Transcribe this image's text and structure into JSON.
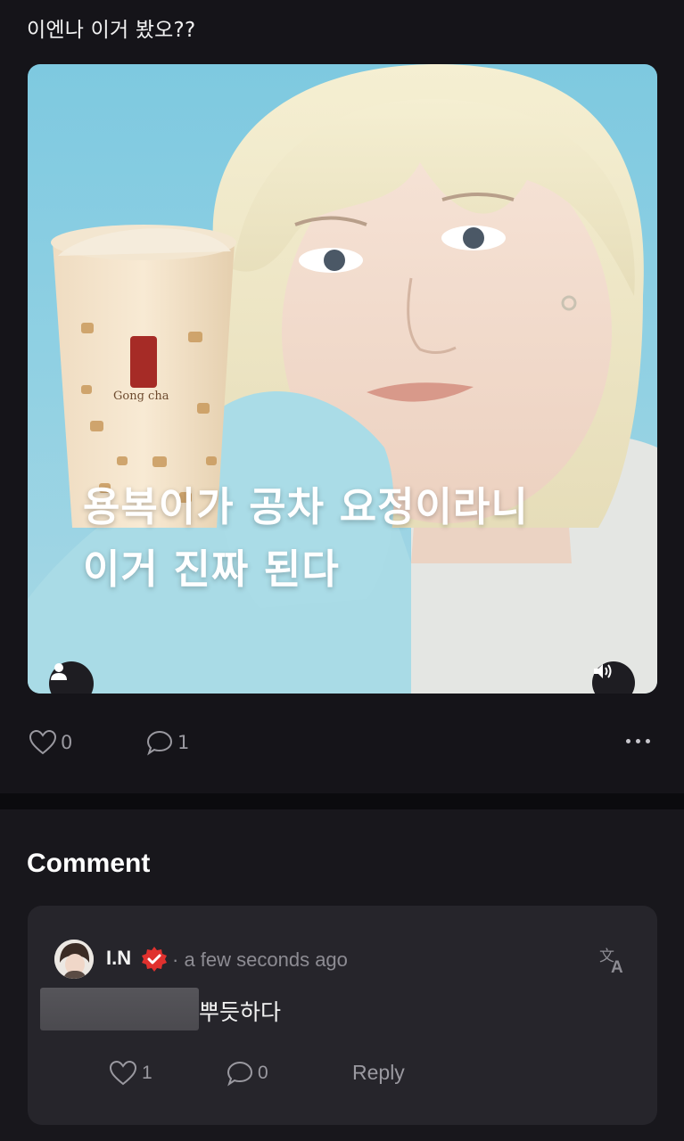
{
  "post": {
    "text": "이엔나 이거 봤오??",
    "media": {
      "caption_line1": "용복이가 공차 요정이라니",
      "caption_line2": "이거 진짜 된다",
      "brand_text": "Gong cha"
    },
    "like_count": "0",
    "comment_count": "1"
  },
  "comments": {
    "heading": "Comment",
    "items": [
      {
        "author": "I.N",
        "time": "· a few seconds ago",
        "text": "뿌듯하다",
        "like_count": "1",
        "reply_count": "0",
        "reply_label": "Reply"
      }
    ]
  },
  "colors": {
    "background": "#151419",
    "card": "#26252b",
    "muted": "#9a99a0",
    "verified_badge": "#e0312e"
  },
  "icons": [
    "person-icon",
    "speaker-icon",
    "heart-icon",
    "comment-bubble-icon",
    "more-dots-icon",
    "verified-badge-icon",
    "translate-icon"
  ]
}
